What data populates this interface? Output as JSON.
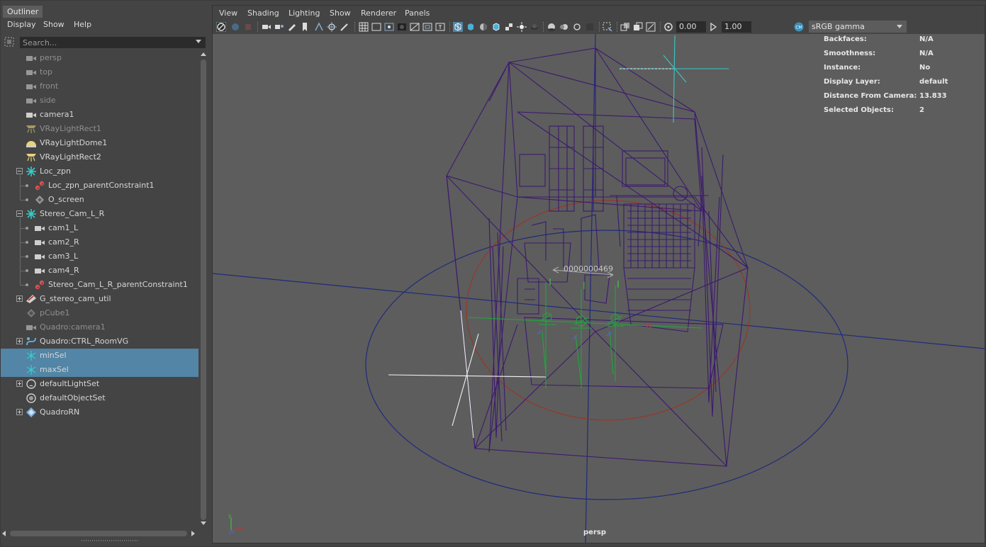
{
  "outliner": {
    "tab_title": "Outliner",
    "menu": [
      "Display",
      "Show",
      "Help"
    ],
    "search_placeholder": "Search...",
    "items": [
      {
        "label": "persp",
        "icon": "camera-icon",
        "dim": true
      },
      {
        "label": "top",
        "icon": "camera-icon",
        "dim": true
      },
      {
        "label": "front",
        "icon": "camera-icon",
        "dim": true
      },
      {
        "label": "side",
        "icon": "camera-icon",
        "dim": true
      },
      {
        "label": "camera1",
        "icon": "camera-icon",
        "dim": false
      },
      {
        "label": "VRayLightRect1",
        "icon": "rect-light-icon",
        "dim": true
      },
      {
        "label": "VRayLightDome1",
        "icon": "dome-light-icon",
        "dim": false
      },
      {
        "label": "VRayLightRect2",
        "icon": "rect-light-icon",
        "dim": false
      },
      {
        "label": "Loc_zpn",
        "icon": "locator-icon",
        "dim": false
      },
      {
        "label": "Loc_zpn_parentConstraint1",
        "icon": "constraint-icon",
        "dim": false
      },
      {
        "label": "O_screen",
        "icon": "transform-icon",
        "dim": false
      },
      {
        "label": "Stereo_Cam_L_R",
        "icon": "locator-icon",
        "dim": false
      },
      {
        "label": "cam1_L",
        "icon": "camera-icon",
        "dim": false
      },
      {
        "label": "cam2_R",
        "icon": "camera-icon",
        "dim": false
      },
      {
        "label": "cam3_L",
        "icon": "camera-icon",
        "dim": false
      },
      {
        "label": "cam4_R",
        "icon": "camera-icon",
        "dim": false
      },
      {
        "label": "Stereo_Cam_L_R_parentConstraint1",
        "icon": "constraint-icon",
        "dim": false
      },
      {
        "label": "G_stereo_cam_util",
        "icon": "group-icon",
        "dim": false
      },
      {
        "label": "pCube1",
        "icon": "transform-icon",
        "dim": true
      },
      {
        "label": "Quadro:camera1",
        "icon": "camera-icon",
        "dim": true
      },
      {
        "label": "Quadro:CTRL_RoomVG",
        "icon": "curve-icon",
        "dim": false
      },
      {
        "label": "minSel",
        "icon": "set-icon",
        "dim": false,
        "selected": true
      },
      {
        "label": "maxSel",
        "icon": "set-icon",
        "dim": false,
        "selected": true
      },
      {
        "label": "defaultLightSet",
        "icon": "light-set-icon",
        "dim": false
      },
      {
        "label": "defaultObjectSet",
        "icon": "object-set-icon",
        "dim": false
      },
      {
        "label": "QuadroRN",
        "icon": "reference-icon",
        "dim": false
      }
    ]
  },
  "viewport": {
    "menu": [
      "View",
      "Shading",
      "Lighting",
      "Show",
      "Renderer",
      "Panels"
    ],
    "exposure_value": "0.00",
    "gamma_value": "1.00",
    "color_management": "sRGB gamma",
    "camera_label": "persp",
    "hud": [
      {
        "key": "Backfaces:",
        "value": "N/A"
      },
      {
        "key": "Smoothness:",
        "value": "N/A"
      },
      {
        "key": "Instance:",
        "value": "No"
      },
      {
        "key": "Display Layer:",
        "value": "default"
      },
      {
        "key": "Distance From Camera:",
        "value": "13.833"
      },
      {
        "key": "Selected Objects:",
        "value": "2"
      }
    ],
    "manipulator_label": "0000000469",
    "axis_labels": {
      "x": "x",
      "y": "y",
      "z": "z"
    }
  },
  "colors": {
    "selection": "#5285a6",
    "wireframe": "#3c1a6e",
    "green": "#1ea83c",
    "cyan": "#38c9c9"
  }
}
